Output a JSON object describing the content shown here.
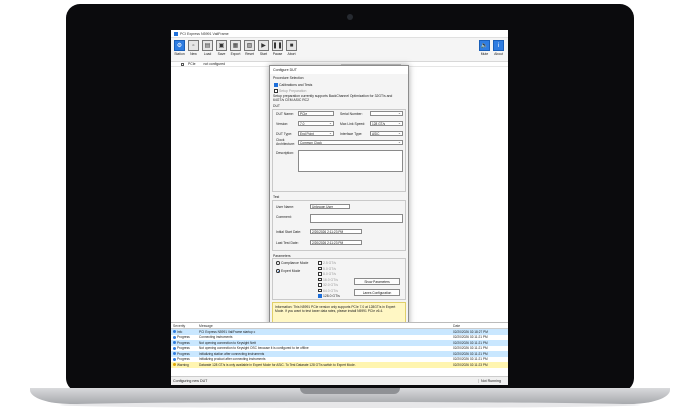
{
  "window": {
    "title": "PCI Express N5991 ValiFrame"
  },
  "toolbar": {
    "buttons": [
      {
        "label": "Station",
        "icon": "station-icon"
      },
      {
        "label": "New",
        "icon": "new-icon"
      },
      {
        "label": "Load",
        "icon": "load-icon"
      },
      {
        "label": "Save",
        "icon": "save-icon"
      },
      {
        "label": "Export",
        "icon": "export-icon"
      },
      {
        "label": "Reset",
        "icon": "reset-icon"
      },
      {
        "label": "Start",
        "icon": "start-icon"
      },
      {
        "label": "Pause",
        "icon": "pause-icon"
      },
      {
        "label": "Abort",
        "icon": "abort-icon"
      }
    ],
    "mute_label": "Mute",
    "about_label": "About"
  },
  "strip": {
    "config": "not configured",
    "sequencer": "Sequencer"
  },
  "dialog": {
    "title": "Configure DUT",
    "procedure_heading": "Procedure Selection",
    "calibrations_label": "Calibrations and Tests",
    "setup_prep_label": "Setup Preparation",
    "setup_note": "Setup preparation currently supports BackChannel Optimization for 32GT/s and 64GT/s CEM ASIC RC2",
    "dut_heading": "DUT",
    "dut_name_label": "DUT Name:",
    "dut_name_value": "PCIe",
    "serial_label": "Serial Number:",
    "version_label": "Version:",
    "version_value": "7.0",
    "max_speed_label": "Max Link Speed:",
    "max_speed_value": "128 GT/s",
    "dut_type_label": "DUT Type:",
    "dut_type_value": "End Point",
    "iface_label": "Interface Type:",
    "iface_value": "ASIC",
    "clock_label": "Clock Architecture:",
    "clock_value": "Common Clock",
    "desc_label": "Description:",
    "test_heading": "Test",
    "user_label": "User Name:",
    "user_value": "Unknown User",
    "comment_label": "Comment:",
    "init_start_label": "Initial Start Date:",
    "init_start_value": "2/20/2026 2:11:23 PM",
    "last_test_label": "Last Test Date:",
    "last_test_value": "2/20/2026 2:11:23 PM",
    "params_heading": "Parameters",
    "compliance_label": "Compliance Mode",
    "expert_label": "Expert Mode",
    "speeds": [
      "2.5 GT/s",
      "5.0 GT/s",
      "8.0 GT/s",
      "16.0 GT/s",
      "32.0 GT/s",
      "64.0 GT/s",
      "128.0 GT/s"
    ],
    "show_params_label": "Show Parameters",
    "lanes_config_label": "Lanes Configuration",
    "info_text": "Information: This N5991 PCIe version only supports PCIe 7.0 at 128GT/s in Expert Mode. If you want to test lower data rates, please install N5991 PCIe v6.4.",
    "ok_label": "OK"
  },
  "log": {
    "headers": {
      "severity": "Severity",
      "message": "Message",
      "date": "Date"
    },
    "rows": [
      {
        "severity": "Info",
        "message": "PCI Express N5991 ValiFrame startup c",
        "date": "02/20/2026 02:18:27 PM"
      },
      {
        "severity": "Progress",
        "message": "Connecting instruments",
        "date": "02/20/2026 02:11:21 PM"
      },
      {
        "severity": "Progress",
        "message": "Not opening connection to Keysight Nett",
        "date": "02/20/2026 02:11:21 PM"
      },
      {
        "severity": "Progress",
        "message": "Not opening connection to Keysight OSC because it is configured to be offline",
        "date": "02/20/2026 02:11:21 PM"
      },
      {
        "severity": "Progress",
        "message": "Initializing station after connecting instruments",
        "date": "02/20/2026 02:11:21 PM"
      },
      {
        "severity": "Progress",
        "message": "Initializing product after connecting instruments",
        "date": "02/20/2026 02:11:21 PM"
      },
      {
        "severity": "Warning",
        "message": "Datarate 128 GT/s is only available in Expert Mode for ASIC. To Test Datarate 128 GT/s switch to Expert Mode.",
        "date": "02/20/2026 02:11:23 PM"
      }
    ]
  },
  "status": {
    "left": "Configuring new DUT",
    "right": "Not Running"
  }
}
